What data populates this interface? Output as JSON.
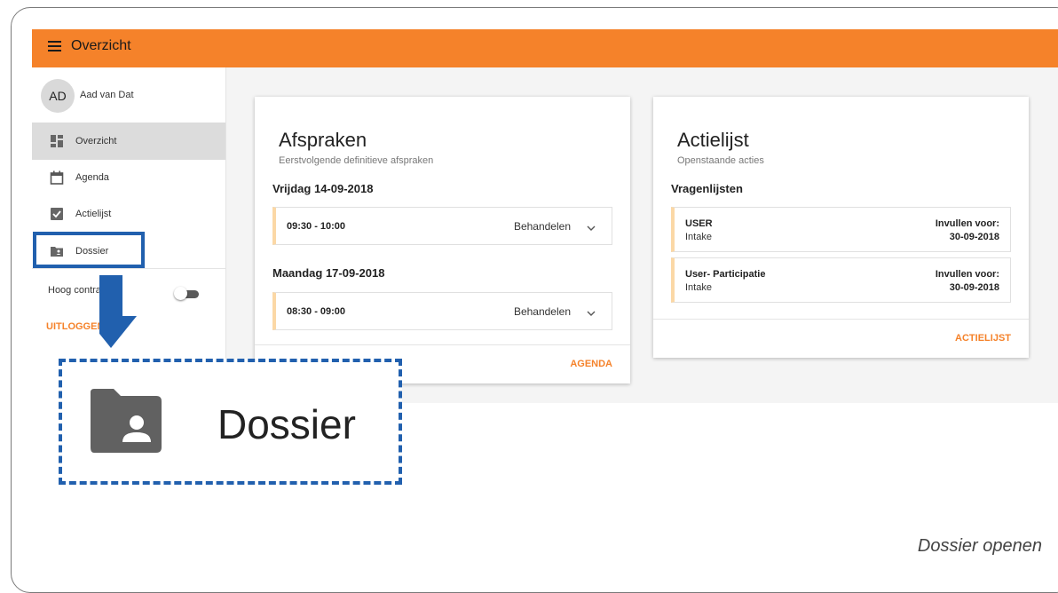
{
  "header": {
    "title": "Overzicht",
    "menu_icon": "menu-icon"
  },
  "user": {
    "initials": "AD",
    "name": "Aad van Dat"
  },
  "sidebar": {
    "items": [
      {
        "label": "Overzicht",
        "icon": "dashboard-icon",
        "active": true
      },
      {
        "label": "Agenda",
        "icon": "calendar-icon",
        "active": false
      },
      {
        "label": "Actielijst",
        "icon": "checkbox-icon",
        "active": false
      },
      {
        "label": "Dossier",
        "icon": "folder-person-icon",
        "active": false
      }
    ],
    "contrast_label": "Hoog contrast",
    "contrast_on": false,
    "logout_label": "UITLOGGEN"
  },
  "appointments": {
    "title": "Afspraken",
    "subtitle": "Eerstvolgende definitieve afspraken",
    "days": [
      {
        "date": "Vrijdag 14-09-2018",
        "time": "09:30 - 10:00",
        "type": "Behandelen"
      },
      {
        "date": "Maandag 17-09-2018",
        "time": "08:30 - 09:00",
        "type": "Behandelen"
      }
    ],
    "link_label": "AGENDA"
  },
  "actions": {
    "title": "Actielijst",
    "subtitle": "Openstaande acties",
    "section": "Vragenlijsten",
    "items": [
      {
        "name": "USER",
        "sub": "Intake",
        "due_label": "Invullen voor:",
        "due_date": "30-09-2018"
      },
      {
        "name": "User- Participatie",
        "sub": "Intake",
        "due_label": "Invullen voor:",
        "due_date": "30-09-2018"
      }
    ],
    "link_label": "ACTIELIJST"
  },
  "annotation": {
    "zoom_label": "Dossier",
    "caption": "Dossier openen",
    "accent_color": "#2160ae"
  },
  "colors": {
    "brand": "#f5822a",
    "annotation": "#2160ae"
  }
}
